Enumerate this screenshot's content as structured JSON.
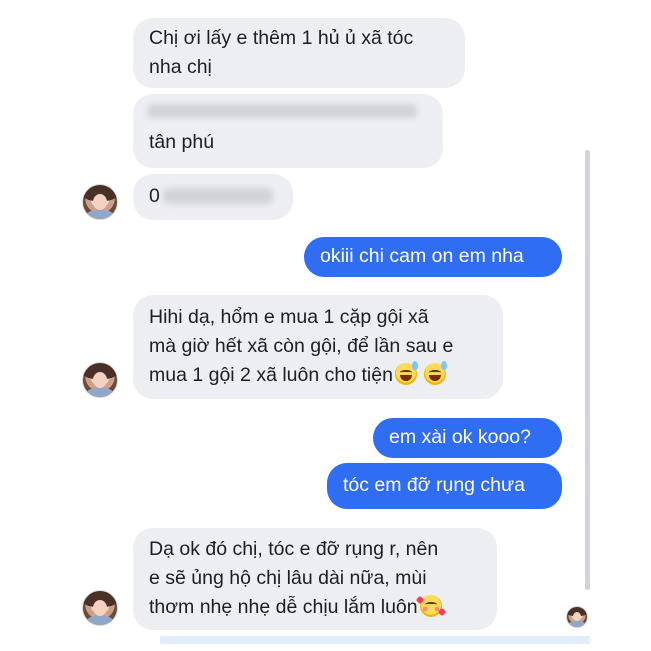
{
  "chat": {
    "messages": [
      {
        "id": "m1",
        "direction": "incoming",
        "lines": [
          "Chị ơi lấy e thêm 1 hủ ủ xã tóc",
          "nha chị"
        ]
      },
      {
        "id": "m2",
        "direction": "incoming",
        "lines": [
          "tân phú"
        ]
      },
      {
        "id": "m3",
        "direction": "incoming",
        "lines": [
          "0"
        ]
      },
      {
        "id": "m4",
        "direction": "outgoing",
        "lines": [
          "okiii chi cam on em nha"
        ]
      },
      {
        "id": "m5",
        "direction": "incoming",
        "lines": [
          "Hihi dạ, hổm e mua 1 cặp gội xã",
          "mà giờ hết xã còn gội, để lần sau e",
          "mua 1 gội 2 xã luôn cho tiện"
        ],
        "trailing_emojis": [
          "grinning-sweat-emoji",
          "grinning-sweat-emoji"
        ]
      },
      {
        "id": "m6",
        "direction": "outgoing",
        "lines": [
          "em xài ok kooo?"
        ]
      },
      {
        "id": "m7",
        "direction": "outgoing",
        "lines": [
          "tóc em đỡ rụng chưa"
        ]
      },
      {
        "id": "m8",
        "direction": "incoming",
        "lines": [
          "Dạ ok đó chị, tóc e đỡ rụng r, nên",
          "e sẽ ủng hộ chị lâu dài nữa, mùi",
          "thơm nhẹ nhẹ dễ chịu lắm luôn"
        ],
        "trailing_emojis": [
          "smiling-face-with-hearts-emoji"
        ]
      }
    ]
  },
  "colors": {
    "incoming_bubble": "#eceef1",
    "outgoing_bubble": "#2f6df2",
    "incoming_text": "#1c1e21",
    "outgoing_text": "#ffffff"
  }
}
